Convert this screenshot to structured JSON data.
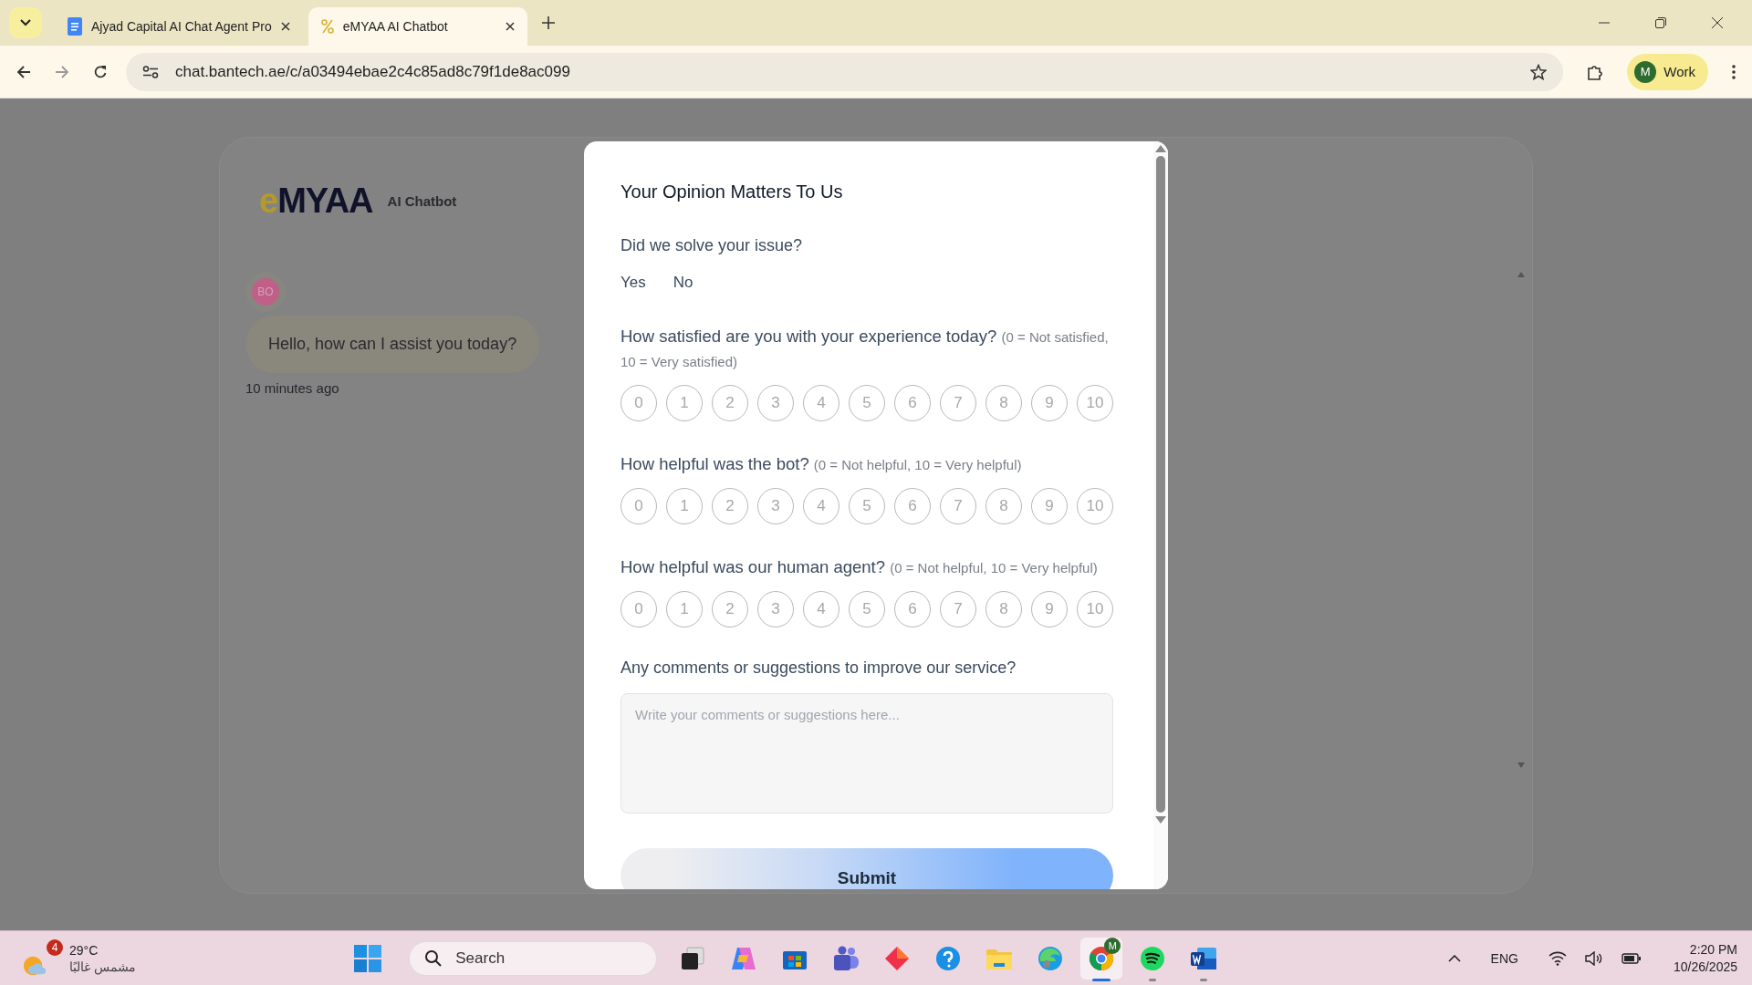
{
  "browser": {
    "tabs": [
      {
        "title": "Ajyad Capital AI Chat Agent Pro",
        "kind": "doc",
        "selected": false
      },
      {
        "title": "eMYAA AI Chatbot",
        "kind": "percent",
        "selected": true
      }
    ],
    "url": "chat.bantech.ae/c/a03494ebae2c4c85ad8c79f1de8ac099",
    "profile": {
      "initial": "M",
      "label": "Work"
    }
  },
  "chat": {
    "logo": "eMYAA",
    "product": "AI Chatbot",
    "avatar": "BO",
    "message": "Hello, how can I assist you today?",
    "time": "10 minutes ago"
  },
  "survey": {
    "title": "Your Opinion Matters To Us",
    "resolved": {
      "question": "Did we solve your issue?",
      "options": [
        {
          "label": "Yes",
          "selected": false
        },
        {
          "label": "No",
          "selected": false
        }
      ]
    },
    "ratings": [
      {
        "question": "How satisfied are you with your experience today?",
        "hint": "(0 = Not satisfied, 10 = Very satisfied)",
        "options": [
          {
            "label": "0",
            "selected": false
          },
          {
            "label": "1",
            "selected": false
          },
          {
            "label": "2",
            "selected": false
          },
          {
            "label": "3",
            "selected": false
          },
          {
            "label": "4",
            "selected": false
          },
          {
            "label": "5",
            "selected": false
          },
          {
            "label": "6",
            "selected": false
          },
          {
            "label": "7",
            "selected": false
          },
          {
            "label": "8",
            "selected": false
          },
          {
            "label": "9",
            "selected": false
          },
          {
            "label": "10",
            "selected": false
          }
        ]
      },
      {
        "question": "How helpful was the bot?",
        "hint": "(0 = Not helpful, 10 = Very helpful)",
        "options": [
          {
            "label": "0",
            "selected": false
          },
          {
            "label": "1",
            "selected": false
          },
          {
            "label": "2",
            "selected": false
          },
          {
            "label": "3",
            "selected": false
          },
          {
            "label": "4",
            "selected": false
          },
          {
            "label": "5",
            "selected": false
          },
          {
            "label": "6",
            "selected": false
          },
          {
            "label": "7",
            "selected": false
          },
          {
            "label": "8",
            "selected": false
          },
          {
            "label": "9",
            "selected": false
          },
          {
            "label": "10",
            "selected": false
          }
        ]
      },
      {
        "question": "How helpful was our human agent?",
        "hint": "(0 = Not helpful, 10 = Very helpful)",
        "options": [
          {
            "label": "0",
            "selected": false
          },
          {
            "label": "1",
            "selected": false
          },
          {
            "label": "2",
            "selected": false
          },
          {
            "label": "3",
            "selected": false
          },
          {
            "label": "4",
            "selected": false
          },
          {
            "label": "5",
            "selected": false
          },
          {
            "label": "6",
            "selected": false
          },
          {
            "label": "7",
            "selected": false
          },
          {
            "label": "8",
            "selected": false
          },
          {
            "label": "9",
            "selected": false
          },
          {
            "label": "10",
            "selected": false
          }
        ]
      }
    ],
    "comments": {
      "question": "Any comments or suggestions to improve our service?",
      "placeholder": "Write your comments or suggestions here..."
    },
    "submit": "Submit"
  },
  "taskbar": {
    "weather": {
      "badge": "4",
      "temp": "29°C",
      "condition": "مشمس غالبًا"
    },
    "search": "Search",
    "apps": [
      {
        "kind": "taskview",
        "open": false,
        "focused": false
      },
      {
        "kind": "copilot",
        "open": false,
        "focused": false
      },
      {
        "kind": "store",
        "open": false,
        "focused": false
      },
      {
        "kind": "teams",
        "open": false,
        "focused": false
      },
      {
        "kind": "diamond",
        "open": false,
        "focused": false
      },
      {
        "kind": "help",
        "open": false,
        "focused": false
      },
      {
        "kind": "folder",
        "open": false,
        "focused": false
      },
      {
        "kind": "edge",
        "open": false,
        "focused": false
      },
      {
        "kind": "chrome",
        "open": true,
        "focused": true,
        "badge": "M"
      },
      {
        "kind": "spotify",
        "open": true,
        "focused": false
      },
      {
        "kind": "word",
        "open": true,
        "focused": false
      }
    ],
    "language": "ENG",
    "time": "2:20 PM",
    "date": "10/26/2025"
  }
}
